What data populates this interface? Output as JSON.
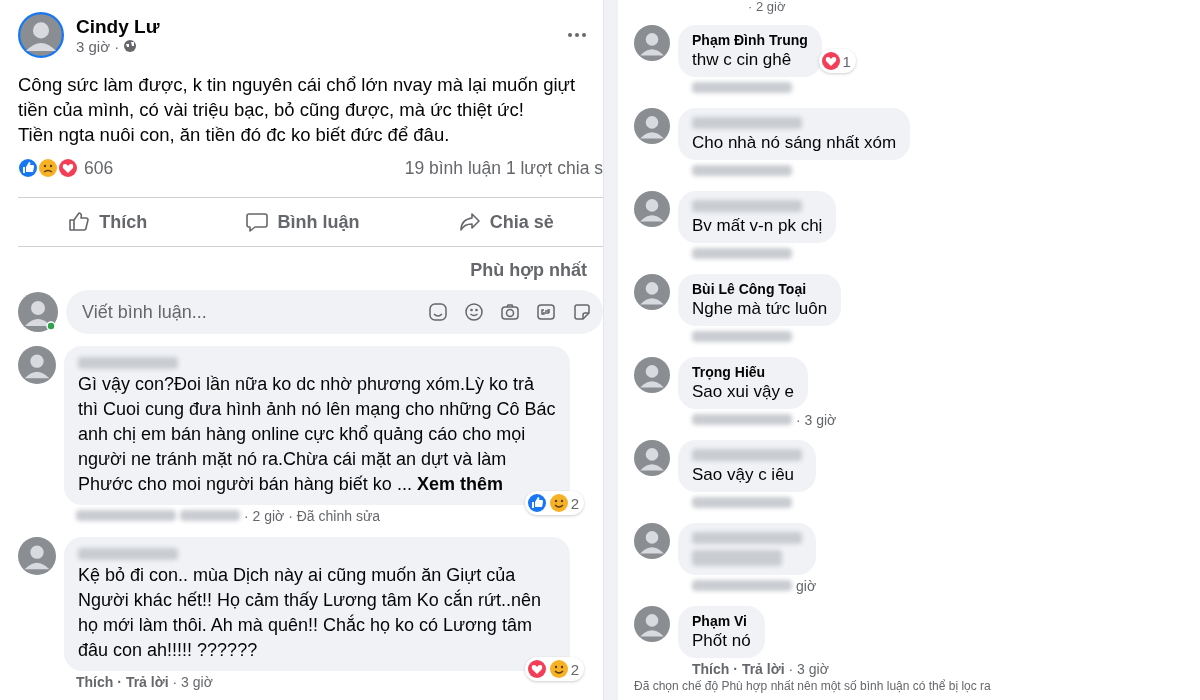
{
  "post": {
    "author": "Cindy Lư",
    "time": "3 giờ ·",
    "text": "Công sức làm được, k tin nguyên cái chổ lớn nvay mà lại muốn giựt tiền của mình, có vài triệu bạc, bỏ cũng được, mà ức thiệt ức!\nTiền ngta nuôi con, ăn tiền đó đc ko biết đức để đâu.",
    "reactions": [
      {
        "kind": "like"
      },
      {
        "kind": "sad"
      },
      {
        "kind": "love"
      }
    ],
    "reaction_count": "606",
    "comment_count": "19 bình luận",
    "share_count": "1 lượt chia s",
    "actions": [
      {
        "kind": "like",
        "label": "Thích"
      },
      {
        "kind": "comment",
        "label": "Bình luận"
      },
      {
        "kind": "share",
        "label": "Chia sẻ"
      }
    ],
    "sort": "Phù hợp nhất",
    "comment_placeholder": "Viết bình luận...",
    "online": true
  },
  "left_comments": [
    {
      "text": "Gì vậy con?Đoi lần nữa ko dc nhờ phương xóm.Lỳ ko trả thì Cuoi cung đưa hình ảnh nó lên mạng cho những Cô Bác anh chị em bán hàng online cực khổ quảng cáo cho mọi người ne tránh mặt nó ra.Chừa cái mặt an dựt và làm Phước cho moi người bán hàng biết ko ... **Xem thêm**",
      "reactions": [
        {
          "kind": "like"
        },
        {
          "kind": "haha"
        }
      ],
      "reaction_count": "2",
      "meta": [
        {
          "kind": "blurred"
        },
        {
          "kind": "blurred"
        },
        {
          "kind": "info",
          "text": "· 2 giờ · Đã chỉnh sửa"
        }
      ]
    },
    {
      "text": "Kệ bỏ đi con.. mùa Dịch này ai cũng muốn ăn Giựt của Người khác hết!! Họ cảm thấy Lương tâm Ko cắn rứt..nên họ mới làm thôi. Ah mà quên!! Chắc họ ko có Lương tâm đâu con ah!!!!! ??????",
      "reactions": [
        {
          "kind": "love"
        },
        {
          "kind": "haha"
        }
      ],
      "reaction_count": "2",
      "meta": [
        {
          "kind": "action",
          "text": "Thích"
        },
        {
          "kind": "action",
          "text": "· Trả lời"
        },
        {
          "kind": "info",
          "text": "· 3 giờ"
        }
      ]
    }
  ],
  "right_top_meta": "· 2 giờ",
  "right_comments": [
    {
      "name": "Phạm Đình Trung",
      "text": "thw c cin ghê",
      "reactions": [
        {
          "kind": "love"
        }
      ],
      "reaction_count": "1",
      "meta": [
        {
          "kind": "blurred"
        }
      ]
    },
    {
      "text": "Cho nhà nó sáng nhất xóm",
      "meta": [
        {
          "kind": "blurred"
        }
      ]
    },
    {
      "text": "Bv mất v-n pk chị",
      "meta": [
        {
          "kind": "blurred"
        }
      ]
    },
    {
      "name": "Bùi Lê Công Toại",
      "text": "Nghe mà tức luôn",
      "meta": [
        {
          "kind": "blurred"
        }
      ]
    },
    {
      "name": "Trọng Hiếu",
      "text": "Sao xui vậy e",
      "meta": [
        {
          "kind": "blurred"
        },
        {
          "kind": "info",
          "text": "· 3 giờ"
        }
      ]
    },
    {
      "text": "Sao vậy c iêu",
      "meta": [
        {
          "kind": "blurred"
        }
      ]
    },
    {
      "meta": [
        {
          "kind": "blurred"
        },
        {
          "kind": "info",
          "text": "giờ"
        }
      ]
    },
    {
      "name": "Phạm Vi",
      "text": "Phốt nó",
      "meta": [
        {
          "kind": "action",
          "text": "Thích"
        },
        {
          "kind": "action",
          "text": "· Trả lời"
        },
        {
          "kind": "info",
          "text": "· 3 giờ"
        }
      ]
    }
  ],
  "notice": "Đã chọn chế độ Phù hợp nhất nên một số bình luận có thể bị lọc ra"
}
